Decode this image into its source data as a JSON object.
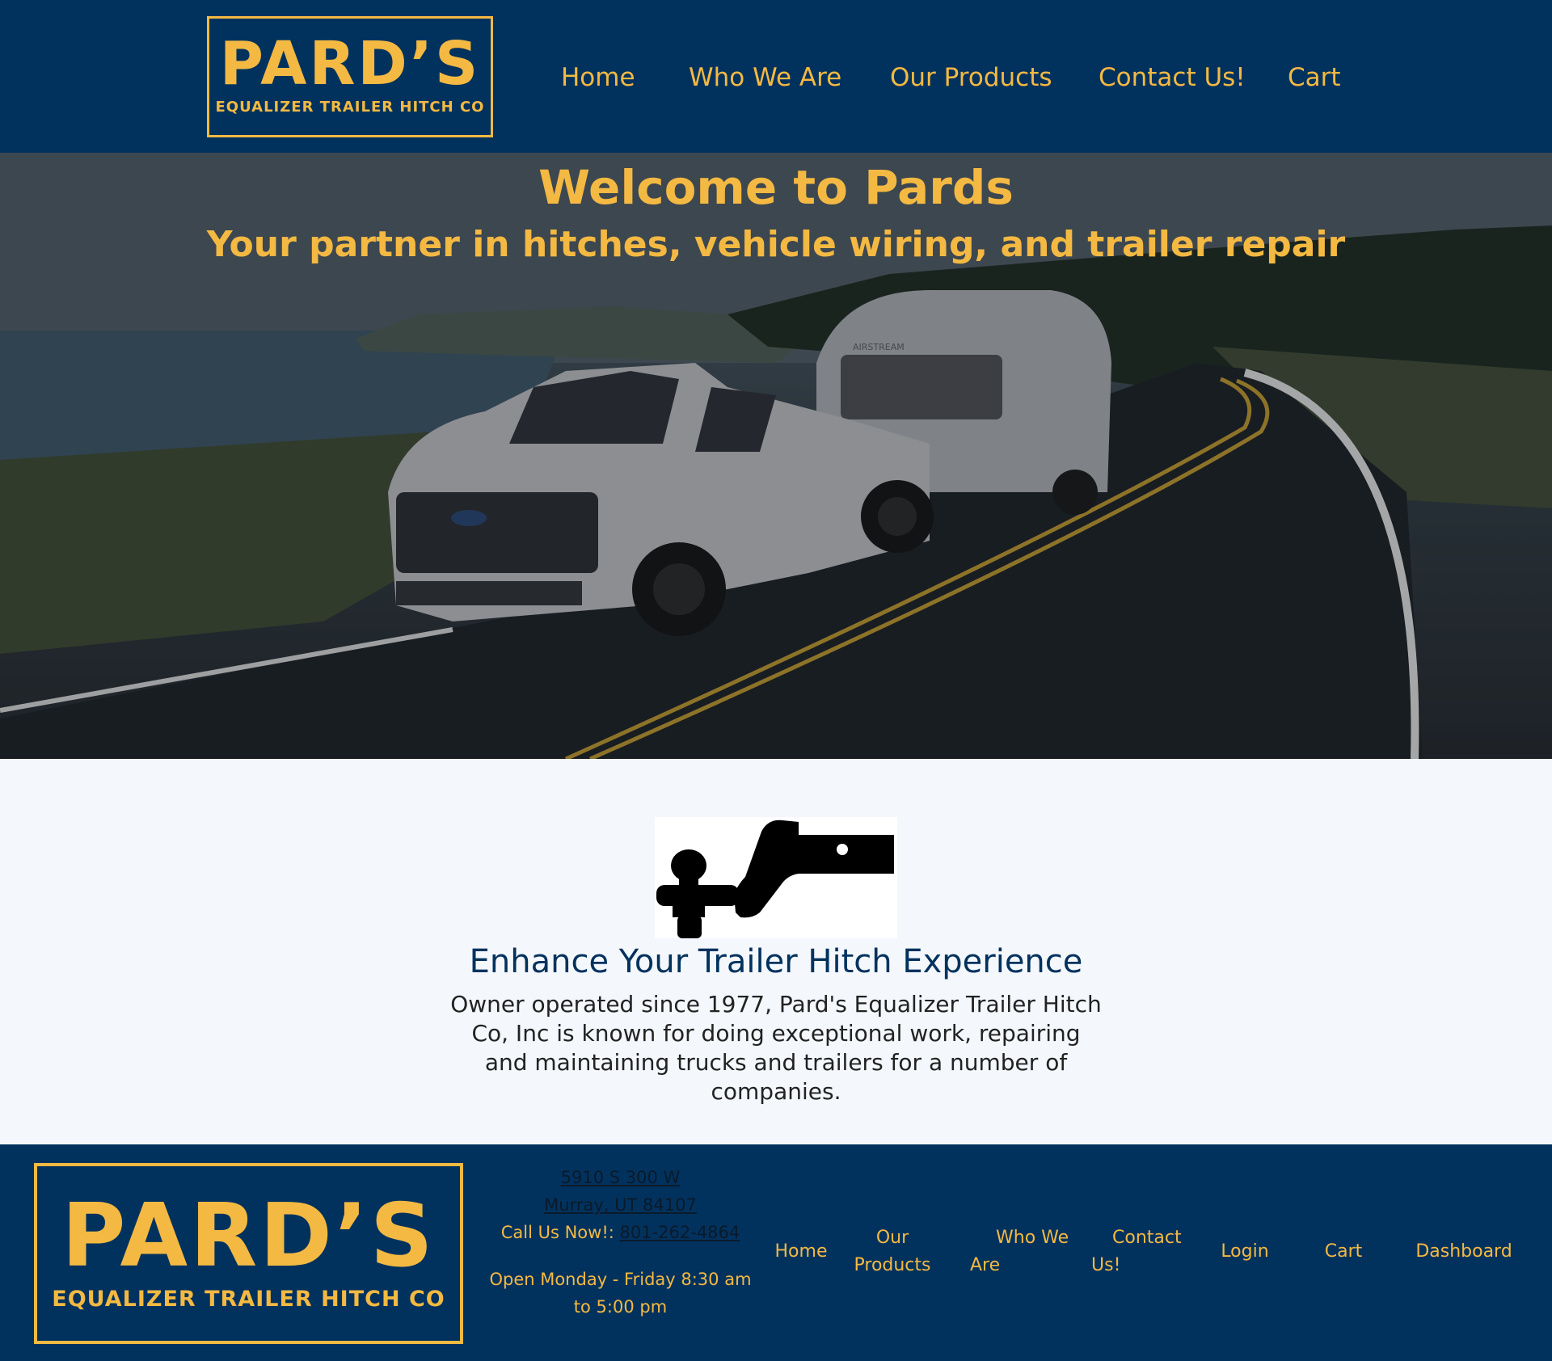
{
  "header": {
    "logo_big": "PARD’S",
    "logo_small": "EQUALIZER TRAILER HITCH CO",
    "nav": [
      "Home",
      "Who We Are",
      "Our Products",
      "Contact Us!",
      "Cart"
    ]
  },
  "hero": {
    "title": "Welcome to Pards",
    "subtitle": "Your partner in hitches, vehicle wiring, and trailer repair",
    "trailer_brand": "AIRSTREAM"
  },
  "main": {
    "icon": "trailer-hitch-icon",
    "heading": "Enhance Your Trailer Hitch Experience",
    "body": "Owner operated since 1977, Pard's Equalizer Trailer Hitch Co, Inc is known for doing exceptional work, repairing and maintaining trucks and trailers for a number of companies."
  },
  "footer": {
    "logo_big": "PARD’S",
    "logo_small": "EQUALIZER TRAILER HITCH CO",
    "address_line1": "5910 S 300 W",
    "address_line2": "Murray, UT 84107",
    "call_label": "Call Us Now!: ",
    "phone": "801-262-4864",
    "hours": "Open Monday - Friday 8:30 am to 5:00 pm",
    "nav": [
      "Home",
      "Our Products",
      "Who We Are",
      "Contact Us!",
      "Login",
      "Cart",
      "Dashboard"
    ]
  },
  "colors": {
    "navy": "#01325e",
    "gold": "#f4b942",
    "background": "#f4f7fb"
  }
}
